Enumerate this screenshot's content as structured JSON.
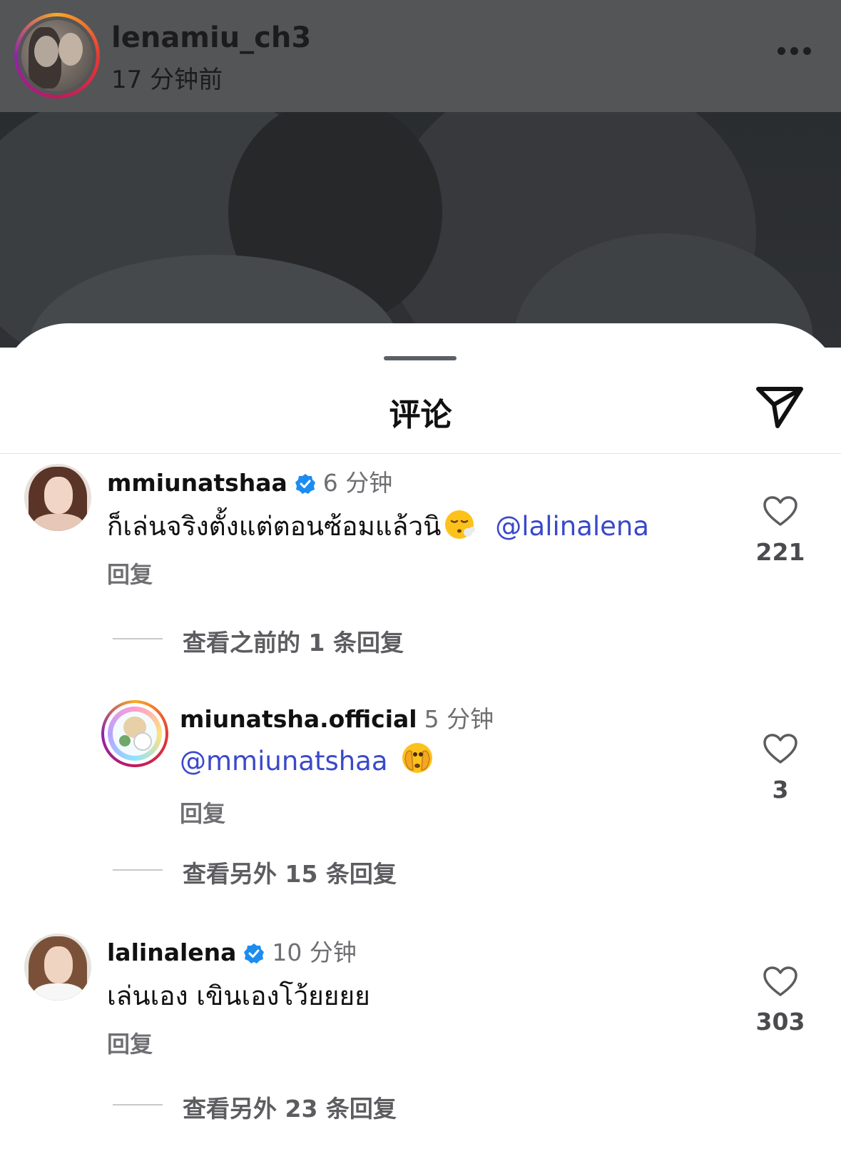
{
  "post": {
    "username": "lenamiu_ch3",
    "time": "17 分钟前",
    "more_icon": "more-horizontal-icon"
  },
  "sheet": {
    "title": "评论",
    "share_icon": "send-icon"
  },
  "comments": [
    {
      "username": "mmiunatshaa",
      "verified": true,
      "time": "6 分钟",
      "text": "ก็เล่นจริงตั้งแต่ตอนซ้อมแล้วนิ",
      "emoji": "face-exhaling-emoji",
      "mention": "@lalinalena",
      "reply_label": "回复",
      "likes": "221"
    },
    {
      "username": "miunatsha.official",
      "verified": false,
      "time": "5 分钟",
      "mention": "@mmiunatshaa",
      "emoji": "face-with-peeking-eye-emoji",
      "reply_label": "回复",
      "likes": "3"
    },
    {
      "username": "lalinalena",
      "verified": true,
      "time": "10 分钟",
      "text": "เล่นเอง เขินเองโว้ยยยย",
      "reply_label": "回复",
      "likes": "303"
    }
  ],
  "view_more": [
    "查看之前的 1 条回复",
    "查看另外 15 条回复",
    "查看另外 23 条回复"
  ],
  "colors": {
    "mention": "#3a49c9",
    "verified": "#1d8cf0",
    "dim_overlay": "#545557"
  }
}
